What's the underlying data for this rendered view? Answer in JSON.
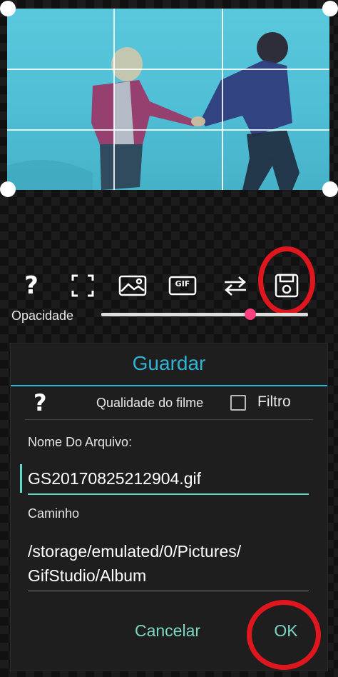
{
  "toolbar": {
    "help_icon": "help-icon",
    "crop_icon": "crop-icon",
    "image_icon": "image-icon",
    "gif_label": "GIF",
    "swap_icon": "swap-icon",
    "save_icon": "save-icon"
  },
  "opacity": {
    "label": "Opacidade",
    "value": 0.72
  },
  "dialog": {
    "title": "Guardar",
    "quality_label": "Qualidade do filme",
    "filter_label": "Filtro",
    "filter_checked": false,
    "filename_label": "Nome Do Arquivo:",
    "filename_value": "GS20170825212904.gif",
    "path_label": "Caminho",
    "path_line1": "/storage/emulated/0/Pictures/",
    "path_line2": "GifStudio/Album",
    "cancel_label": "Cancelar",
    "ok_label": "OK"
  },
  "colors": {
    "accent": "#2fb4d6",
    "button_text": "#7dd6c3",
    "highlight_circle": "#e0161f",
    "slider_thumb": "#ff3f7f"
  }
}
